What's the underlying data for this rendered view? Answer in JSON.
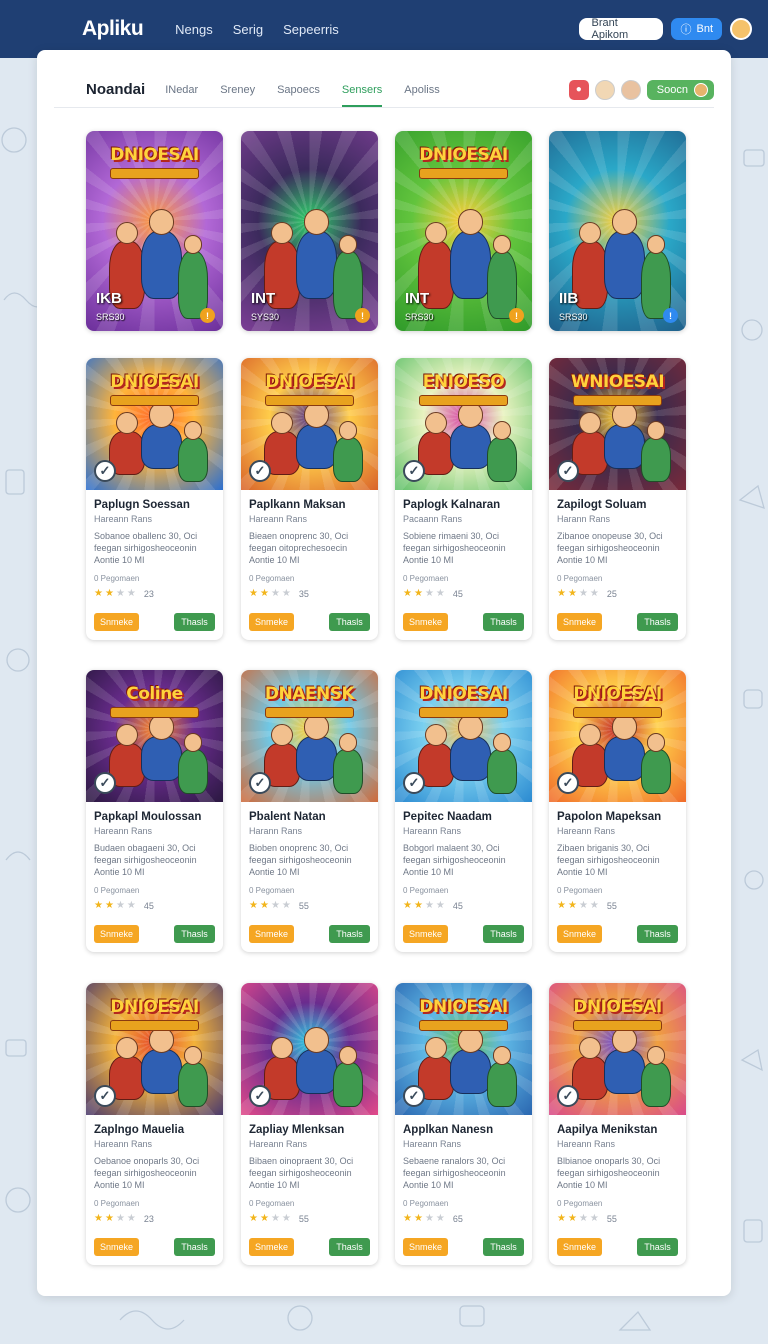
{
  "topbar": {
    "logo": "Apliku",
    "nav": [
      "Nengs",
      "Serig",
      "Sepeerris"
    ],
    "search_label": "Brant Apikom",
    "action_label": "Bnt"
  },
  "panel": {
    "title": "Noandai",
    "tabs": [
      "INedar",
      "Sreney",
      "Sapoecs",
      "Sensers",
      "Apoliss"
    ],
    "active_tab": "Sensers",
    "header_pill": "Soocn"
  },
  "colors": {
    "brand_dark": "#1f3f73",
    "accent_green": "#3f9a4f",
    "accent_yellow": "#f5a623",
    "star": "#f2b51c"
  },
  "featured": [
    {
      "art_title": "DNIOESAI",
      "label": "IKB",
      "sublabel": "SRS30",
      "badge": "!"
    },
    {
      "art_title": "",
      "label": "INT",
      "sublabel": "SYS30",
      "badge": "!"
    },
    {
      "art_title": "DNIOESAI",
      "label": "INT",
      "sublabel": "SRS30",
      "badge": "!"
    },
    {
      "art_title": "",
      "label": "IIB",
      "sublabel": "SRS30",
      "badge": "!"
    }
  ],
  "apps": [
    {
      "art_title": "DNIOESAI",
      "title": "Paplugn Soessan",
      "sub": "Hareann Rans",
      "desc": "Sobanoe oballenc 30, Oci feegan sirhigosheoceonin Aontie 10 MI",
      "meta": "0 Pegomaen",
      "stars": 2,
      "rating": "23",
      "btn1": "Snmeke",
      "btn2": "Thasls"
    },
    {
      "art_title": "DNIOESAI",
      "title": "Paplkann Maksan",
      "sub": "Hareann Rans",
      "desc": "Bieaen onoprenc 30, Oci feegan oitoprechesoecin Aontie 10 MI",
      "meta": "0 Pegomaen",
      "stars": 2,
      "rating": "35",
      "btn1": "Snmeke",
      "btn2": "Thasls"
    },
    {
      "art_title": "ENIOESO",
      "title": "Paplogk Kalnaran",
      "sub": "Pacaann Rans",
      "desc": "Sobiene rimaeni 30, Oci feegan sirhigosheoceonin Aontie 10 MI",
      "meta": "0 Pegomaen",
      "stars": 2,
      "rating": "45",
      "btn1": "Snmeke",
      "btn2": "Thasls"
    },
    {
      "art_title": "WNIOESAI",
      "title": "Zapilogt Soluam",
      "sub": "Harann Rans",
      "desc": "Zibanoe onopeuse 30, Oci feegan sirhigosheoceonin Aontie 10 MI",
      "meta": "0 Pegomaen",
      "stars": 2,
      "rating": "25",
      "btn1": "Snmeke",
      "btn2": "Thasls"
    },
    {
      "art_title": "Coline",
      "title": "Papkapl Moulossan",
      "sub": "Hareann Rans",
      "desc": "Budaen obagaeni 30, Oci feegan sirhigosheoceonin Aontie 10 MI",
      "meta": "0 Pegomaen",
      "stars": 2,
      "rating": "45",
      "btn1": "Snmeke",
      "btn2": "Thasls"
    },
    {
      "art_title": "DNAENSK",
      "title": "Pbalent Natan",
      "sub": "Harann Rans",
      "desc": "Bioben onoprenc 30, Oci feegan sirhigosheoceonin Aontie 10 MI",
      "meta": "0 Pegomaen",
      "stars": 2,
      "rating": "55",
      "btn1": "Snmeke",
      "btn2": "Thasls"
    },
    {
      "art_title": "DNIOESAI",
      "title": "Pepitec Naadam",
      "sub": "Hareann Rans",
      "desc": "Bobgorl malaent 30, Oci feegan sirhigosheoceonin Aontie 10 MI",
      "meta": "0 Pegomaen",
      "stars": 2,
      "rating": "45",
      "btn1": "Snmeke",
      "btn2": "Thasls"
    },
    {
      "art_title": "DNIOESAI",
      "title": "Papolon Mapeksan",
      "sub": "Hareann Rans",
      "desc": "Zibaen briganis 30, Oci feegan sirhigosheoceonin Aontie 10 MI",
      "meta": "0 Pegomaen",
      "stars": 2,
      "rating": "55",
      "btn1": "Snmeke",
      "btn2": "Thasls"
    },
    {
      "art_title": "DNIOESAI",
      "title": "Zaplngo Mauelia",
      "sub": "Hareann Rans",
      "desc": "Oebanoe onoparls 30, Oci feegan sirhigosheoceonin Aontie 10 MI",
      "meta": "0 Pegomaen",
      "stars": 2,
      "rating": "23",
      "btn1": "Snmeke",
      "btn2": "Thasls"
    },
    {
      "art_title": "",
      "title": "Zapliay Mlenksan",
      "sub": "Hareann Rans",
      "desc": "Bibaen oinopraent 30, Oci feegan sirhigosheoceonin Aontie 10 MI",
      "meta": "0 Pegomaen",
      "stars": 2,
      "rating": "55",
      "btn1": "Snmeke",
      "btn2": "Thasls"
    },
    {
      "art_title": "DNIOESAI",
      "title": "Applkan Nanesn",
      "sub": "Hareann Rans",
      "desc": "Sebaene ranalors 30, Oci feegan sirhigosheoceonin Aontie 10 MI",
      "meta": "0 Pegomaen",
      "stars": 2,
      "rating": "65",
      "btn1": "Snmeke",
      "btn2": "Thasls"
    },
    {
      "art_title": "DNIOESAI",
      "title": "Aapilya Menikstan",
      "sub": "Hareann Rans",
      "desc": "Blbianoe onoparls 30, Oci feegan sirhigosheoceonin Aontie 10 MI",
      "meta": "0 Pegomaen",
      "stars": 2,
      "rating": "55",
      "btn1": "Snmeke",
      "btn2": "Thasls"
    }
  ]
}
